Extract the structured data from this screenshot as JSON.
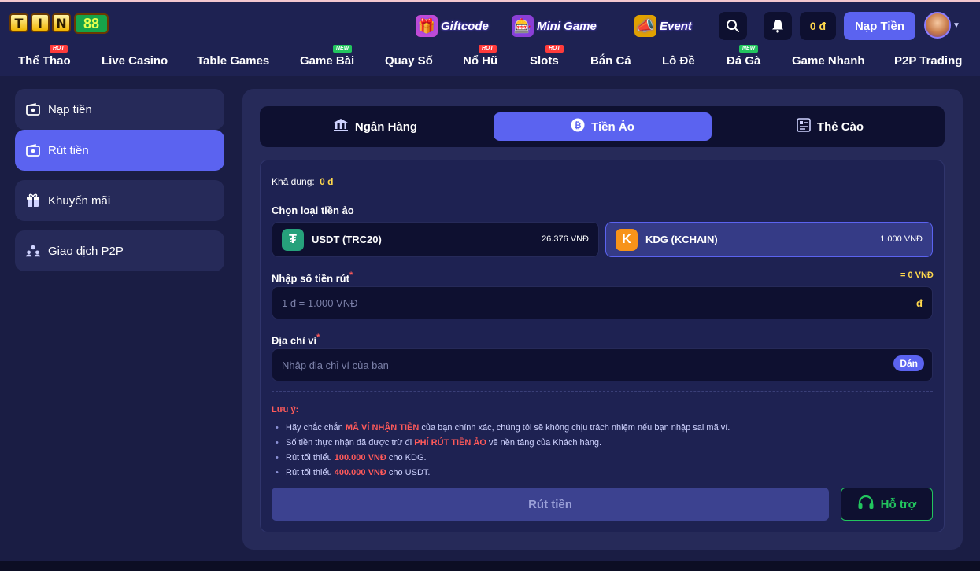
{
  "brand": {
    "letters": [
      "T",
      "I",
      "N"
    ],
    "number": "88"
  },
  "promos": [
    {
      "label": "Giftcode",
      "icon": "gift-icon"
    },
    {
      "label": "Mini Game",
      "icon": "slot-machine-icon"
    },
    {
      "label": "Event",
      "icon": "megaphone-icon"
    }
  ],
  "header": {
    "balance": "0 đ",
    "deposit_button": "Nạp Tiền"
  },
  "nav": [
    {
      "label": "Thể Thao",
      "badge": "HOT"
    },
    {
      "label": "Live Casino",
      "badge": ""
    },
    {
      "label": "Table Games",
      "badge": ""
    },
    {
      "label": "Game Bài",
      "badge": "NEW"
    },
    {
      "label": "Quay Số",
      "badge": ""
    },
    {
      "label": "Nổ Hũ",
      "badge": "HOT"
    },
    {
      "label": "Slots",
      "badge": "HOT"
    },
    {
      "label": "Bắn Cá",
      "badge": ""
    },
    {
      "label": "Lô Đề",
      "badge": ""
    },
    {
      "label": "Đá Gà",
      "badge": "NEW"
    },
    {
      "label": "Game Nhanh",
      "badge": ""
    },
    {
      "label": "P2P Trading",
      "badge": ""
    }
  ],
  "sidebar": {
    "items": [
      {
        "label": "Nạp tiền",
        "icon": "wallet-icon"
      },
      {
        "label": "Rút tiền",
        "icon": "wallet-icon"
      },
      {
        "label": "Khuyến mãi",
        "icon": "gift-icon"
      },
      {
        "label": "Giao dịch P2P",
        "icon": "users-icon"
      }
    ]
  },
  "tabs": [
    {
      "label": "Ngân Hàng",
      "icon": "bank-icon"
    },
    {
      "label": "Tiền Ảo",
      "icon": "bitcoin-icon"
    },
    {
      "label": "Thẻ Cào",
      "icon": "card-icon"
    }
  ],
  "withdraw": {
    "available_label": "Khả dụng:",
    "available_value": "0 đ",
    "coin_title": "Chọn loại tiền ảo",
    "coins": [
      {
        "name": "USDT (TRC20)",
        "rate": "26.376 VNĐ",
        "color": "#26a17b",
        "glyph": "₮"
      },
      {
        "name": "KDG (KCHAIN)",
        "rate": "1.000 VNĐ",
        "color": "#f7931a",
        "glyph": "K"
      }
    ],
    "amount_label": "Nhập số tiền rút",
    "amount_converted": "= 0 VNĐ",
    "amount_placeholder": "1 đ = 1.000 VNĐ",
    "amount_unit": "đ",
    "address_label": "Địa chỉ ví",
    "address_placeholder": "Nhập địa chỉ ví của bạn",
    "paste_button": "Dán",
    "required_mark": "*"
  },
  "notes": {
    "title": "Lưu ý:",
    "items": [
      {
        "pre": "Hãy chắc chắn ",
        "highlight": "MÃ VÍ NHẬN TIỀN",
        "post": " của bạn chính xác, chúng tôi sẽ không chịu trách nhiệm nếu bạn nhập sai mã ví."
      },
      {
        "pre": "Số tiền thực nhận đã được trừ đi ",
        "highlight": "PHÍ RÚT TIỀN ẢO",
        "post": " về nền tảng của Khách hàng."
      },
      {
        "pre": "Rút tối thiểu ",
        "highlight": "100.000 VNĐ",
        "post": " cho KDG."
      },
      {
        "pre": "Rút tối thiểu ",
        "highlight": "400.000 VNĐ",
        "post": " cho USDT."
      }
    ]
  },
  "actions": {
    "submit": "Rút tiền",
    "support": "Hỗ trợ"
  },
  "colors": {
    "accent": "#5b63f0",
    "panel": "#262a59",
    "background": "#1a1d44",
    "support": "#22c55e",
    "warning": "#ff5a5a",
    "balance": "#ffd84d"
  }
}
